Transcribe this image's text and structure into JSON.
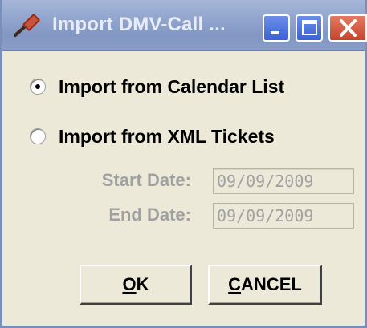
{
  "window": {
    "title": "Import DMV-Call ...",
    "icon": "gavel-icon",
    "controls": {
      "minimize": "minimize-icon",
      "maximize": "maximize-icon",
      "close": "close-icon"
    }
  },
  "options": [
    {
      "label": "Import from Calendar List",
      "checked": true
    },
    {
      "label": "Import from XML Tickets",
      "checked": false
    }
  ],
  "dates": {
    "start_label": "Start Date:",
    "start_value": "09/09/2009",
    "end_label": "End Date:",
    "end_value": "09/09/2009",
    "enabled": false
  },
  "buttons": {
    "ok_mnemonic": "O",
    "ok_rest": "K",
    "cancel_mnemonic": "C",
    "cancel_rest": "ANCEL"
  },
  "colors": {
    "titlebar": "#8ea2cc",
    "dialog_bg": "#ece9d8",
    "disabled_text": "#a0a0a0",
    "close_button": "#c6442c",
    "window_button": "#3a63d6"
  }
}
